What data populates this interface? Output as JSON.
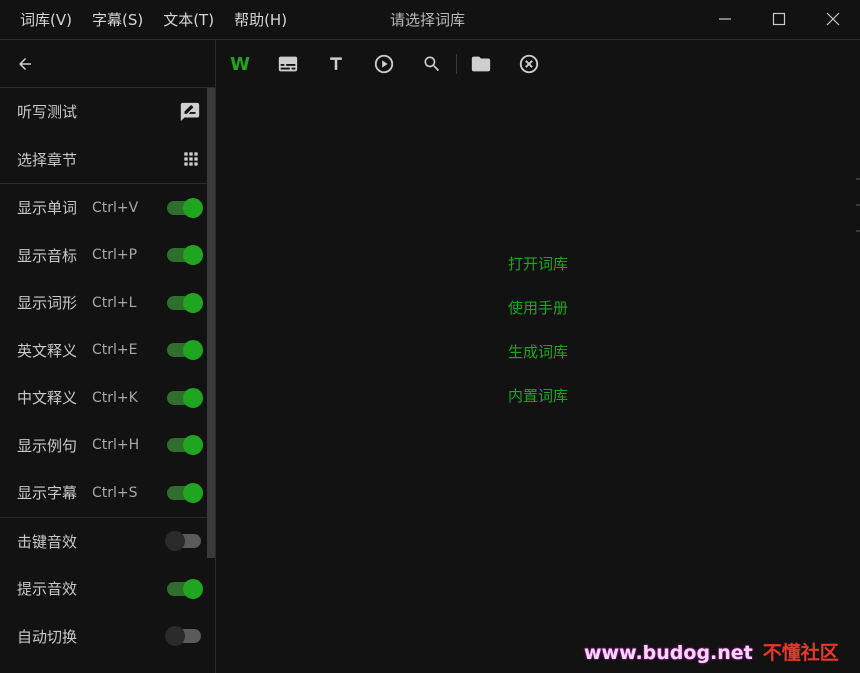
{
  "menu": [
    {
      "label": "词库(V)"
    },
    {
      "label": "字幕(S)"
    },
    {
      "label": "文本(T)"
    },
    {
      "label": "帮助(H)"
    }
  ],
  "window": {
    "title": "请选择词库"
  },
  "sidebar": {
    "section1": [
      {
        "label": "听写测试",
        "icon": "rate-review-icon"
      },
      {
        "label": "选择章节",
        "icon": "apps-grid-icon"
      }
    ],
    "section2": [
      {
        "label": "显示单词",
        "shortcut": "Ctrl+V",
        "on": true
      },
      {
        "label": "显示音标",
        "shortcut": "Ctrl+P",
        "on": true
      },
      {
        "label": "显示词形",
        "shortcut": "Ctrl+L",
        "on": true
      },
      {
        "label": "英文释义",
        "shortcut": "Ctrl+E",
        "on": true
      },
      {
        "label": "中文释义",
        "shortcut": "Ctrl+K",
        "on": true
      },
      {
        "label": "显示例句",
        "shortcut": "Ctrl+H",
        "on": true
      },
      {
        "label": "显示字幕",
        "shortcut": "Ctrl+S",
        "on": true
      }
    ],
    "section3": [
      {
        "label": "击键音效",
        "on": false
      },
      {
        "label": "提示音效",
        "on": true
      },
      {
        "label": "自动切换",
        "on": false
      }
    ]
  },
  "toolbar": {
    "word_letter": "W"
  },
  "links": [
    {
      "label": "打开词库"
    },
    {
      "label": "使用手册"
    },
    {
      "label": "生成词库"
    },
    {
      "label": "内置词库"
    }
  ],
  "watermark": {
    "url": "www.budog.net",
    "name": "不懂社区"
  },
  "colors": {
    "accent": "#1fa51f",
    "background": "#121212",
    "text": "#c9c9c9"
  }
}
